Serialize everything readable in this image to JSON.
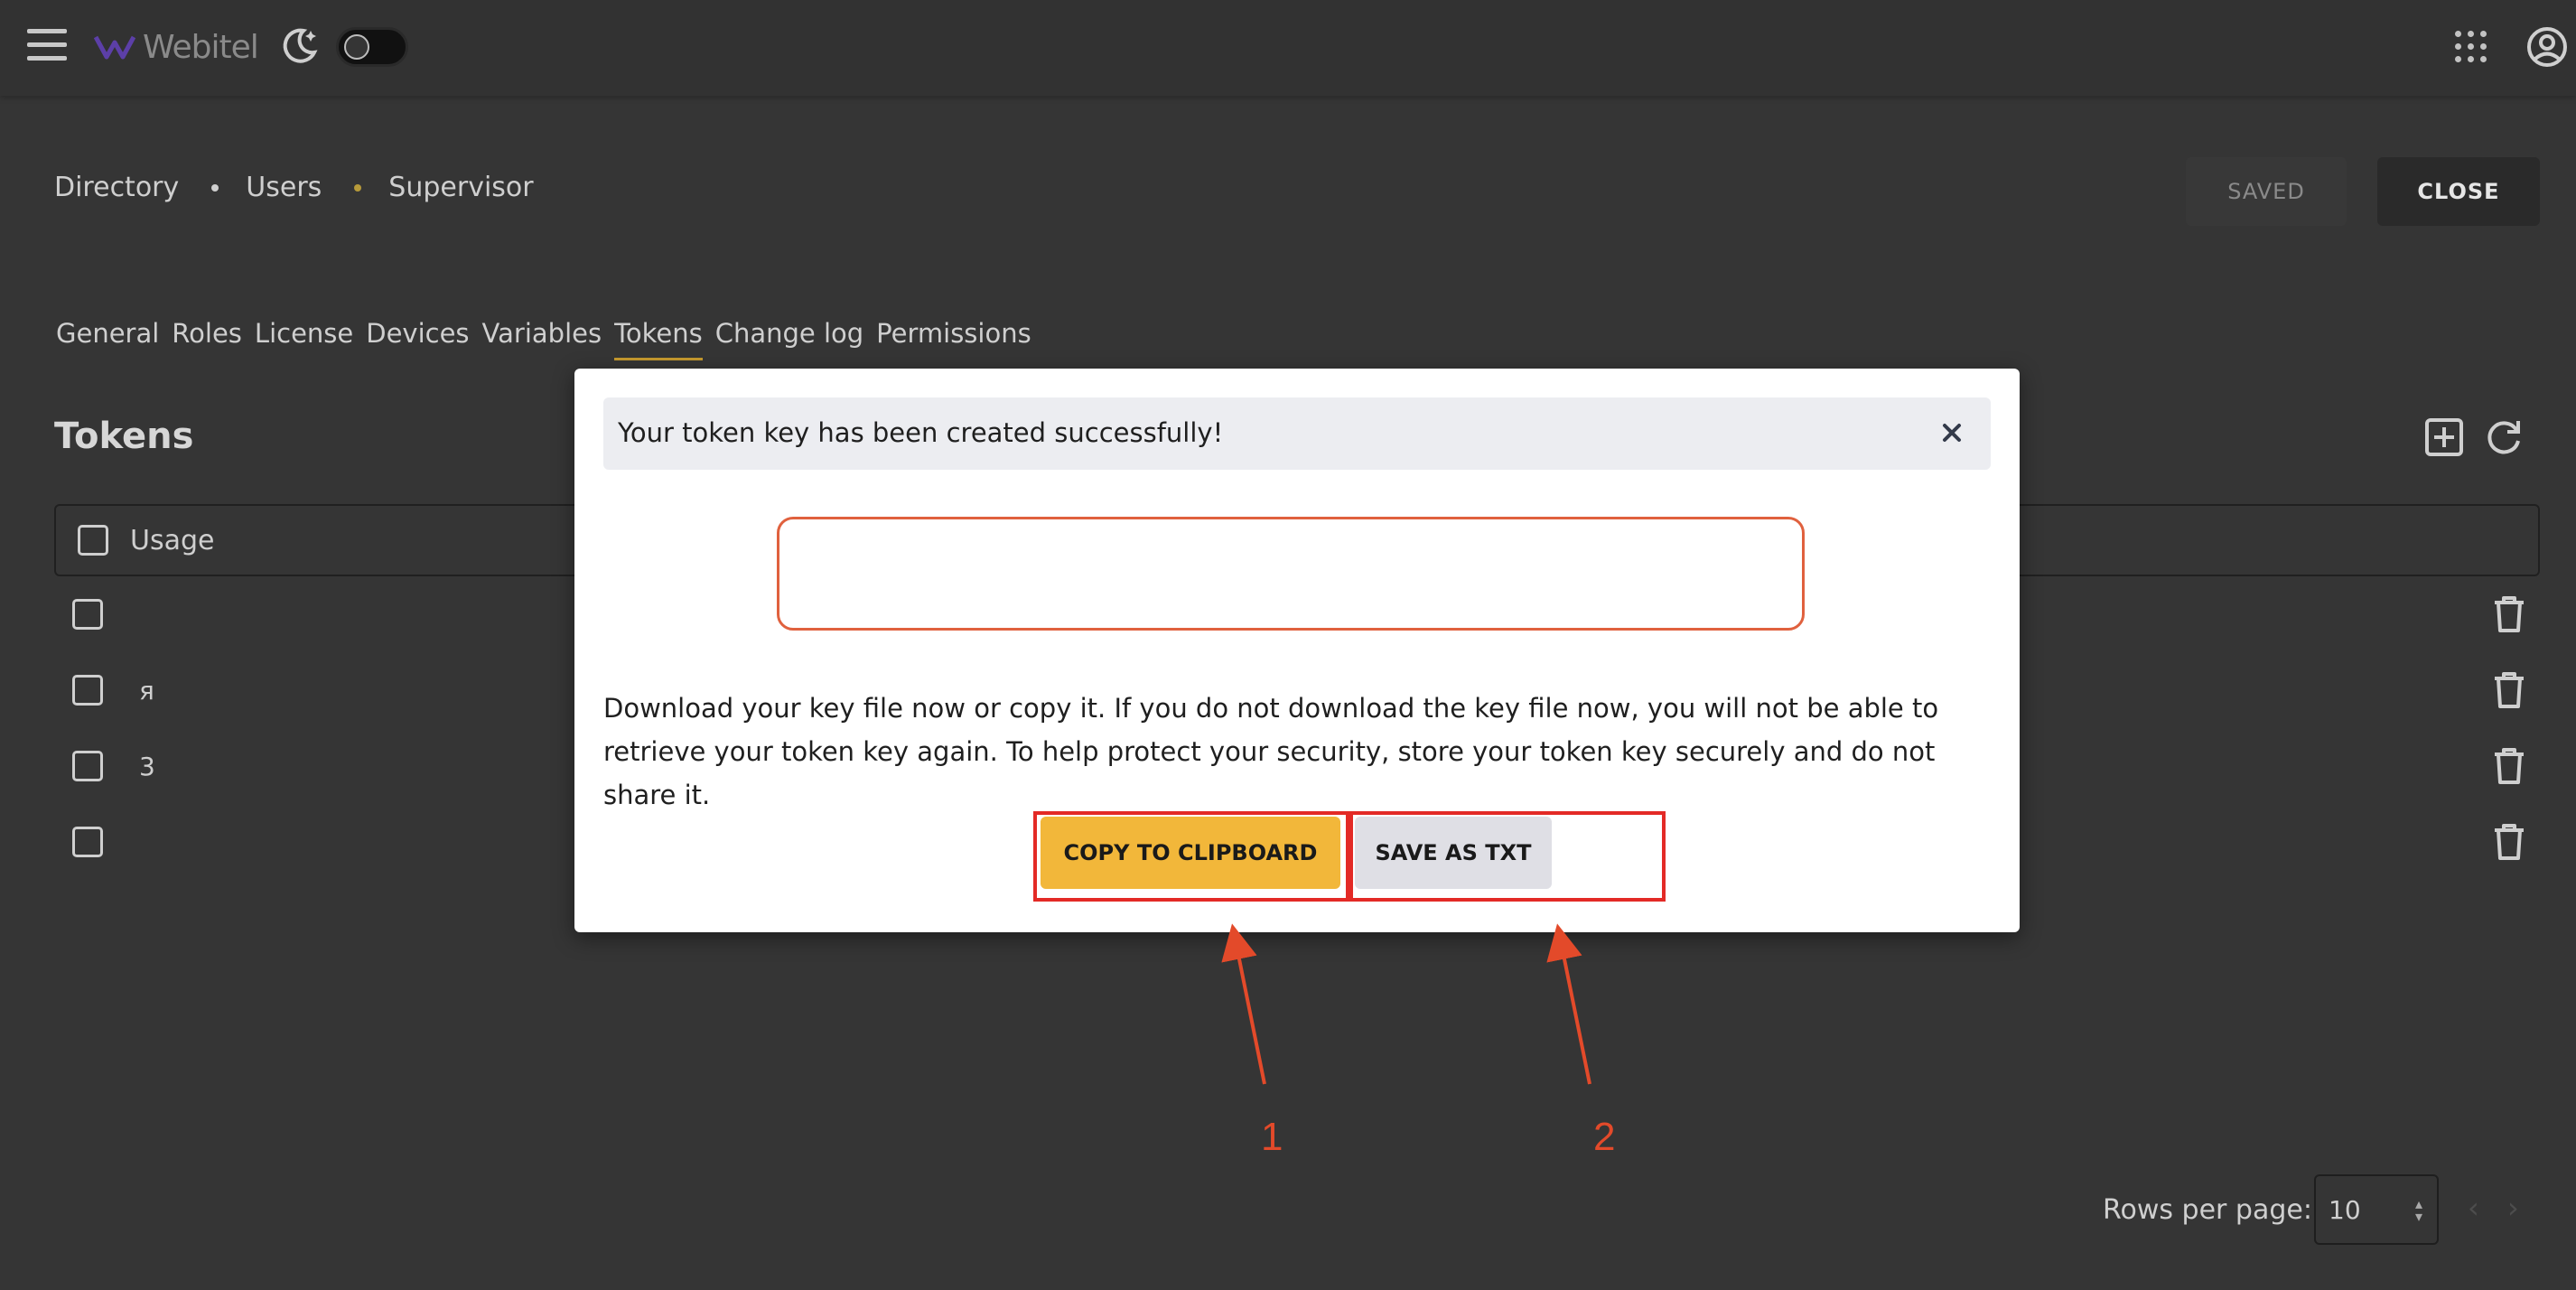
{
  "app": {
    "logo_text": "Webitel",
    "icons": {
      "menu": "hamburger-icon",
      "theme": "moon-icon",
      "apps": "apps-grid-icon",
      "account": "account-icon"
    }
  },
  "breadcrumb": {
    "items": [
      "Directory",
      "Users",
      "Supervisor"
    ]
  },
  "header_actions": {
    "saved_label": "SAVED",
    "close_label": "CLOSE"
  },
  "tabs": [
    {
      "label": "General"
    },
    {
      "label": "Roles"
    },
    {
      "label": "License"
    },
    {
      "label": "Devices"
    },
    {
      "label": "Variables"
    },
    {
      "label": "Tokens",
      "active": true
    },
    {
      "label": "Change log"
    },
    {
      "label": "Permissions"
    }
  ],
  "tokens": {
    "title": "Tokens",
    "column_usage": "Usage",
    "rows": [
      {
        "usage": ""
      },
      {
        "usage": "я"
      },
      {
        "usage": "3"
      },
      {
        "usage": ""
      }
    ]
  },
  "pagination": {
    "rows_per_page_label": "Rows per page:",
    "rows_per_page_value": "10"
  },
  "modal": {
    "title": "Your token key has been created successfully!",
    "token_value": "",
    "message": "Download your key file now or copy it. If you do not download the key file now, you will not be able to retrieve your token key again. To help protect your security, store your token key securely and do not share it.",
    "copy_label": "COPY TO CLIPBOARD",
    "save_label": "SAVE AS TXT"
  },
  "annotations": {
    "callout_1": "1",
    "callout_2": "2"
  },
  "colors": {
    "accent": "#f2b73a",
    "annotation_red": "#e32a26",
    "token_field_border": "#e0613e",
    "background": "#353535"
  }
}
